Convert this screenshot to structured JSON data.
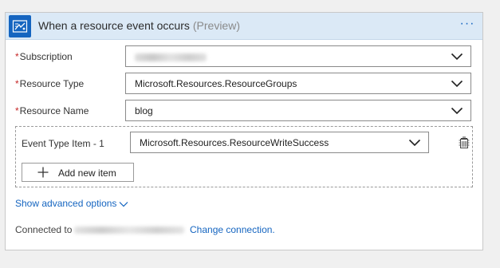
{
  "header": {
    "title": "When a resource event occurs",
    "preview_tag": "(Preview)",
    "menu_icon": "ellipsis-icon",
    "accent": "#1565c0"
  },
  "fields": {
    "subscription": {
      "required_mark": "*",
      "label": "Subscription",
      "value": ""
    },
    "resource_type": {
      "required_mark": "*",
      "label": "Resource Type",
      "value": "Microsoft.Resources.ResourceGroups"
    },
    "resource_name": {
      "required_mark": "*",
      "label": "Resource Name",
      "value": "blog"
    }
  },
  "event_type_group": {
    "label": "Event Type Item - 1",
    "value": "Microsoft.Resources.ResourceWriteSuccess",
    "add_label": "Add new item"
  },
  "advanced": {
    "label": "Show advanced options"
  },
  "connection": {
    "prefix": "Connected to",
    "change_label": "Change connection."
  }
}
